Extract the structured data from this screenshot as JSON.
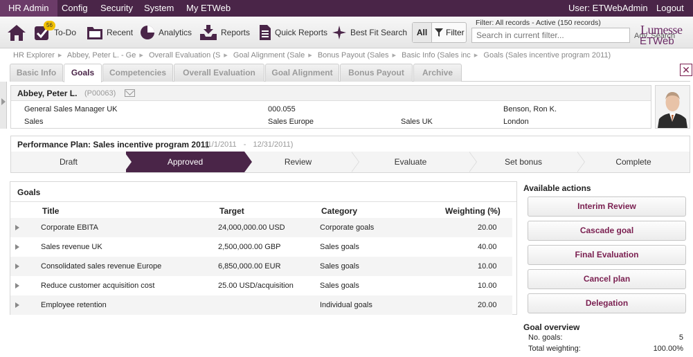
{
  "topmenu": {
    "items": [
      "HR Admin",
      "Config",
      "Security",
      "System",
      "My ETWeb"
    ],
    "user": "User: ETWebAdmin",
    "logout": "Logout"
  },
  "toolbar": {
    "home_icon": "home-icon",
    "todo_label": "To-Do",
    "todo_badge": "56",
    "recent_label": "Recent",
    "analytics_label": "Analytics",
    "reports_label": "Reports",
    "quickreports_label": "Quick Reports",
    "bestfit_label": "Best Fit Search",
    "all_label": "All",
    "filter_label": "Filter",
    "filter_status": "Filter: All records - Active (150 records)",
    "search_placeholder": "Search in current filter...",
    "adv_search": "Adv. Search",
    "logo_line1": "Lumesse",
    "logo_line2": "ETWeb"
  },
  "breadcrumb": [
    "HR Explorer",
    "Abbey, Peter L. - Ge",
    "Overall Evaluation (S",
    "Goal Alignment (Sale",
    "Bonus Payout (Sales",
    "Basic Info (Sales inc",
    "Goals (Sales incentive program 2011)"
  ],
  "tabs": [
    "Basic Info",
    "Goals",
    "Competencies",
    "Overall Evaluation",
    "Goal Alignment",
    "Bonus Payout",
    "Archive"
  ],
  "active_tab": "Goals",
  "employee": {
    "name": "Abbey, Peter L.",
    "id": "(P00063)",
    "position": "General Sales Manager UK",
    "department": "Sales",
    "cost_center": "000.055",
    "region": "Sales Europe",
    "unit": "Sales UK",
    "manager": "Benson, Ron K.",
    "location": "London"
  },
  "plan": {
    "title": "Performance Plan: Sales incentive program 2011",
    "start": "(1/1/2011",
    "dash": "-",
    "end": "12/31/2011)",
    "steps": [
      "Draft",
      "Approved",
      "Review",
      "Evaluate",
      "Set bonus",
      "Complete"
    ],
    "active_step": "Approved"
  },
  "goals": {
    "heading": "Goals",
    "columns": [
      "Title",
      "Target",
      "Category",
      "Weighting (%)"
    ],
    "rows": [
      {
        "title": "Corporate EBITA",
        "target": "24,000,000.00 USD",
        "category": "Corporate goals",
        "weighting": "20.00"
      },
      {
        "title": "Sales revenue UK",
        "target": "2,500,000.00 GBP",
        "category": "Sales goals",
        "weighting": "40.00"
      },
      {
        "title": "Consolidated sales revenue Europe",
        "target": "6,850,000.00 EUR",
        "category": "Sales goals",
        "weighting": "10.00"
      },
      {
        "title": "Reduce customer acquisition cost",
        "target": "25.00 USD/acquisition",
        "category": "Sales goals",
        "weighting": "10.00"
      },
      {
        "title": "Employee retention",
        "target": "",
        "category": "Individual goals",
        "weighting": "20.00"
      }
    ]
  },
  "actions": {
    "heading": "Available actions",
    "buttons": [
      "Interim Review",
      "Cascade goal",
      "Final Evaluation",
      "Cancel plan",
      "Delegation"
    ]
  },
  "overview": {
    "heading": "Goal overview",
    "no_goals_label": "No. goals:",
    "no_goals_value": "5",
    "total_label": "Total weighting:",
    "total_value": "100.00%"
  },
  "colors": {
    "brand": "#4a2548",
    "accent": "#7a1f50",
    "badge": "#f2c000"
  }
}
